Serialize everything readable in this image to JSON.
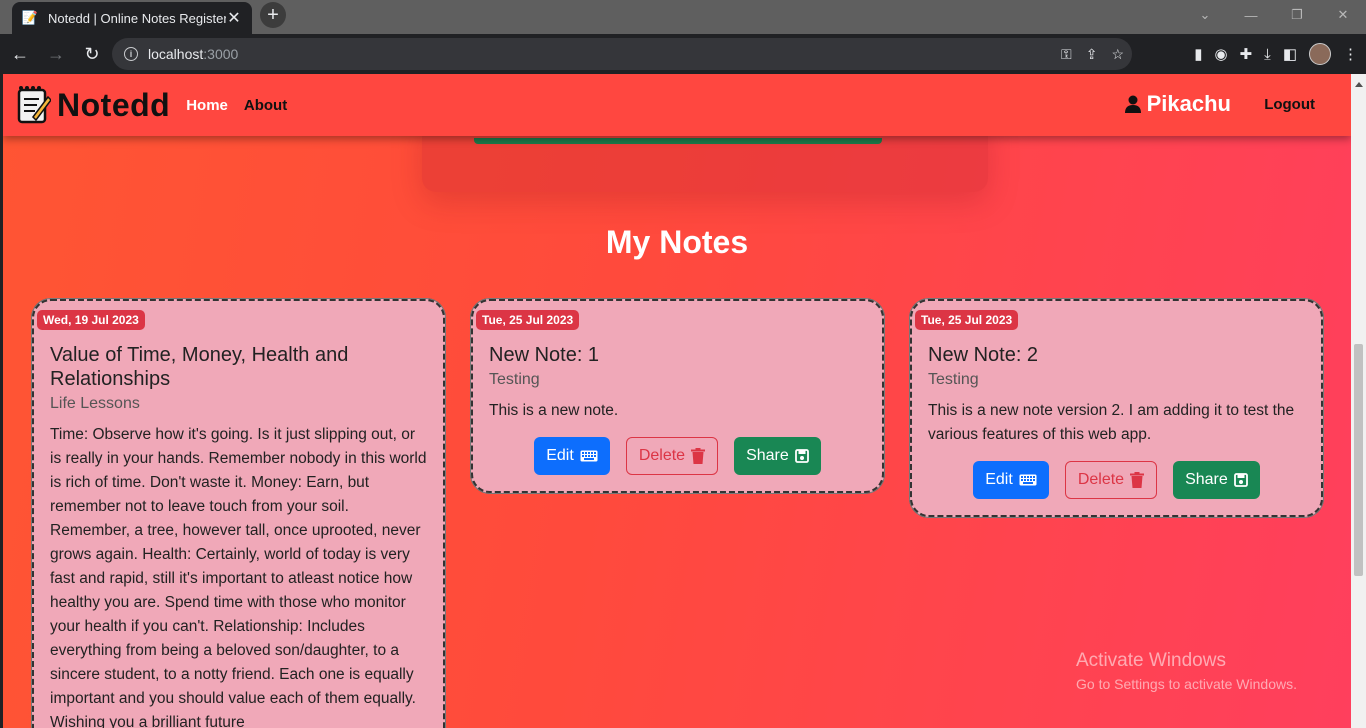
{
  "browser": {
    "tab_title": "Notedd | Online Notes Register",
    "url_host": "localhost",
    "url_port": ":3000",
    "new_tab_label": "+",
    "tab_close_label": "✕"
  },
  "app": {
    "brand": "Notedd",
    "nav": {
      "home": "Home",
      "about": "About"
    },
    "user": "Pikachu",
    "logout": "Logout"
  },
  "main": {
    "section_title": "My Notes",
    "notes": [
      {
        "date": "Wed, 19 Jul 2023",
        "title": "Value of Time, Money, Health and Relationships",
        "tag": "Life Lessons",
        "body": "Time: Observe how it's going. Is it just slipping out, or is really in your hands. Remember nobody in this world is rich of time. Don't waste it. Money: Earn, but remember not to leave touch from your soil. Remember, a tree, however tall, once uprooted, never grows again. Health: Certainly, world of today is very fast and rapid, still it's important to atleast notice how healthy you are. Spend time with those who monitor your health if you can't. Relationship: Includes everything from being a beloved son/daughter, to a sincere student, to a notty friend. Each one is equally important and you should value each of them equally. Wishing you a brilliant future"
      },
      {
        "date": "Tue, 25 Jul 2023",
        "title": "New Note: 1",
        "tag": "Testing",
        "body": "This is a new note."
      },
      {
        "date": "Tue, 25 Jul 2023",
        "title": "New Note: 2",
        "tag": "Testing",
        "body": "This is a new note version 2. I am adding it to test the various features of this web app."
      }
    ],
    "buttons": {
      "edit": "Edit",
      "delete": "Delete",
      "share": "Share"
    }
  },
  "watermark": {
    "line1": "Activate Windows",
    "line2": "Go to Settings to activate Windows."
  },
  "colors": {
    "navbar": "#ff4740",
    "card": "#f0a8b8",
    "badge": "#dc3545",
    "edit": "#0d6efd",
    "share": "#198754"
  }
}
